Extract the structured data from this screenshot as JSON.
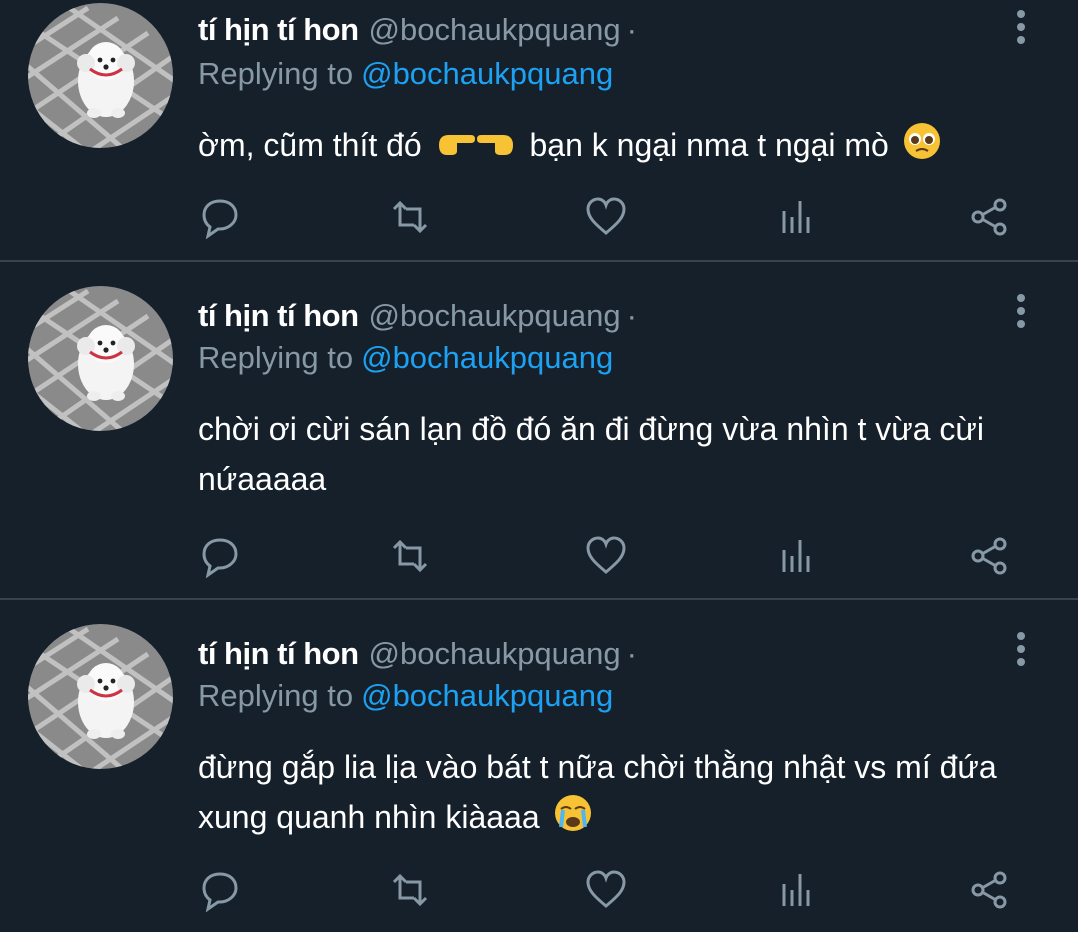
{
  "colors": {
    "background": "#15202b",
    "divider": "#38444d",
    "muted": "#8899a6",
    "link": "#1da1f2",
    "text": "#ffffff"
  },
  "icons": [
    "avatar-dog",
    "more-vertical-icon",
    "reply-icon",
    "retweet-icon",
    "like-icon",
    "analytics-icon",
    "share-icon"
  ],
  "tweets": [
    {
      "name": "tí hịn tí hon",
      "handle": "@bochaukpquang",
      "separator": "·",
      "replying_label": "Replying to",
      "replying_to": "@bochaukpquang",
      "text_a": "ờm, cũm thít đó",
      "text_b": "bạn k ngại nma t ngại mò",
      "emojis": [
        "pointing-hands-emoji",
        "pleading-face-emoji"
      ]
    },
    {
      "name": "tí hịn tí hon",
      "handle": "@bochaukpquang",
      "separator": "·",
      "replying_label": "Replying to",
      "replying_to": "@bochaukpquang",
      "text": "chời ơi cừi sán lạn đồ đó ăn đi đừng vừa nhìn t vừa cừi nứaaaaa"
    },
    {
      "name": "tí hịn tí hon",
      "handle": "@bochaukpquang",
      "separator": "·",
      "replying_label": "Replying to",
      "replying_to": "@bochaukpquang",
      "text": "đừng gắp lia lịa vào bát t nữa chời thằng nhật vs mí đứa xung quanh nhìn kiàaaa",
      "emojis": [
        "loudly-crying-face-emoji"
      ]
    }
  ]
}
